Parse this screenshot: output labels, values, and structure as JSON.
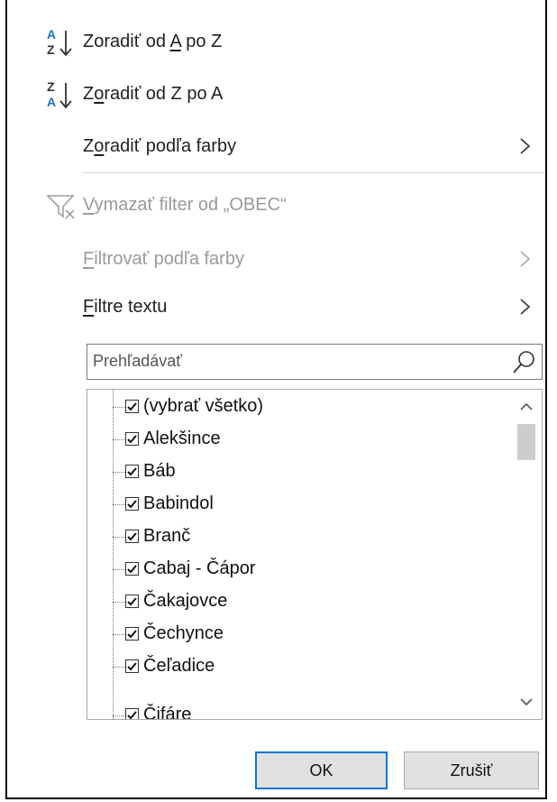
{
  "menu": {
    "sort_az": {
      "pre": "Zoradiť od ",
      "u": "A",
      "post": " po Z"
    },
    "sort_za": {
      "pre": "Z",
      "u": "o",
      "post": "radiť od Z po A"
    },
    "sort_by_color": {
      "pre": "Z",
      "u": "o",
      "post": "radiť podľa farby"
    },
    "clear_filter": {
      "pre": "",
      "u": "V",
      "post": "ymazať filter od „OBEC“"
    },
    "filter_by_color": {
      "pre": "",
      "u": "F",
      "post": "iltrovať podľa farby"
    },
    "text_filters": {
      "pre": "",
      "u": "F",
      "post": "iltre textu"
    }
  },
  "search": {
    "placeholder": "Prehľadávať"
  },
  "list": {
    "items": [
      {
        "label": "(vybrať všetko)",
        "checked": true
      },
      {
        "label": "Alekšince",
        "checked": true
      },
      {
        "label": "Báb",
        "checked": true
      },
      {
        "label": "Babindol",
        "checked": true
      },
      {
        "label": "Branč",
        "checked": true
      },
      {
        "label": "Cabaj - Čápor",
        "checked": true
      },
      {
        "label": "Čakajovce",
        "checked": true
      },
      {
        "label": "Čechynce",
        "checked": true
      },
      {
        "label": "Čeľadice",
        "checked": true
      },
      {
        "label": "Čifáre",
        "checked": true
      }
    ]
  },
  "buttons": {
    "ok": "OK",
    "cancel": "Zrušiť"
  },
  "icons": {
    "sort_az": "sort-ascending-icon",
    "sort_za": "sort-descending-icon",
    "clear_filter": "clear-filter-icon",
    "search": "magnifier-icon",
    "submenu": "chevron-right-icon"
  },
  "colors": {
    "accent": "#0078d7",
    "sort_blue": "#1a73c8",
    "disabled": "#9a9a9a"
  }
}
